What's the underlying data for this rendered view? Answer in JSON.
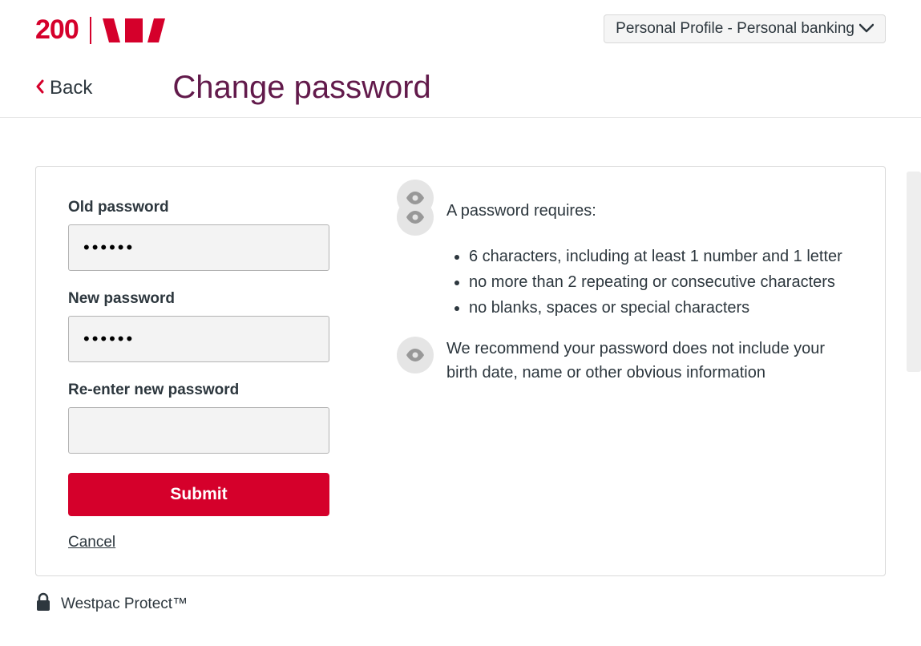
{
  "header": {
    "logo_text": "200",
    "profile_dropdown_label": "Personal Profile - Personal banking"
  },
  "nav": {
    "back_label": "Back",
    "page_title": "Change password"
  },
  "form": {
    "old_password_label": "Old password",
    "old_password_value": "••••••",
    "new_password_label": "New password",
    "new_password_value": "••••••",
    "reenter_label": "Re-enter new password",
    "reenter_value": "",
    "submit_label": "Submit",
    "cancel_label": "Cancel"
  },
  "rules": {
    "intro": "A password requires:",
    "items": [
      "6 characters, including at least 1 number and 1 letter",
      "no more than 2 repeating or consecutive characters",
      "no blanks, spaces or special characters"
    ],
    "recommendation": "We recommend your password does not include your birth date, name or other obvious information"
  },
  "footer": {
    "protect_label": "Westpac Protect™"
  },
  "colors": {
    "brand_red": "#d5002b",
    "heading_purple": "#621a4b",
    "text": "#2d373e"
  }
}
